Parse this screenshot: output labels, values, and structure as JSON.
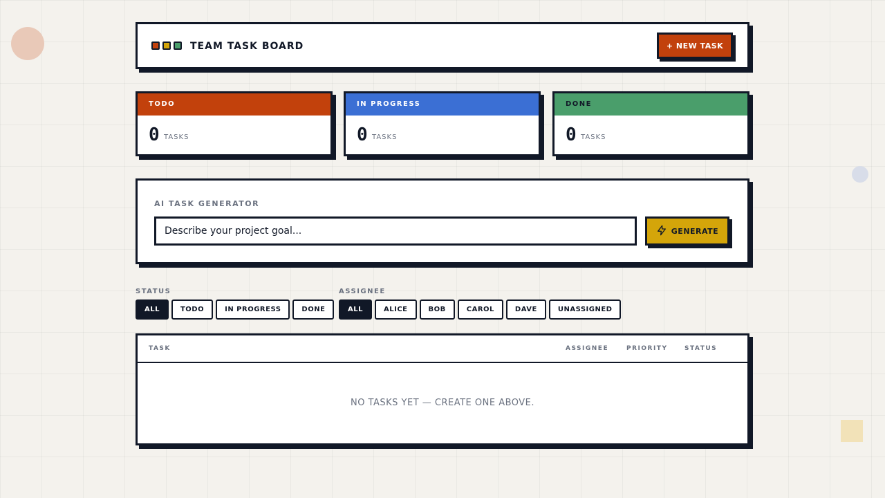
{
  "colors": {
    "accent_red": "#c2410c",
    "accent_blue": "#3b6fd4",
    "accent_green": "#4a9e6b",
    "accent_yellow": "#d4a50a",
    "ink": "#111827",
    "muted": "#6b7280"
  },
  "header": {
    "title": "TEAM TASK BOARD",
    "dots": [
      "#c2410c",
      "#d4a50a",
      "#4a9e6b"
    ],
    "new_task_label": "+ NEW TASK"
  },
  "stats": [
    {
      "label": "TODO",
      "count": "0",
      "unit": "TASKS"
    },
    {
      "label": "IN PROGRESS",
      "count": "0",
      "unit": "TASKS"
    },
    {
      "label": "DONE",
      "count": "0",
      "unit": "TASKS"
    }
  ],
  "generator": {
    "label": "AI TASK GENERATOR",
    "placeholder": "Describe your project goal...",
    "value": "",
    "button_label": "GENERATE",
    "button_icon": "lightning-bolt-icon"
  },
  "filters": {
    "status": {
      "label": "STATUS",
      "options": [
        "ALL",
        "TODO",
        "IN PROGRESS",
        "DONE"
      ],
      "selected": "ALL"
    },
    "assignee": {
      "label": "ASSIGNEE",
      "options": [
        "ALL",
        "ALICE",
        "BOB",
        "CAROL",
        "DAVE",
        "UNASSIGNED"
      ],
      "selected": "ALL"
    }
  },
  "table": {
    "columns": [
      "TASK",
      "ASSIGNEE",
      "PRIORITY",
      "STATUS"
    ],
    "rows": [],
    "empty_message": "NO TASKS YET — CREATE ONE ABOVE."
  }
}
